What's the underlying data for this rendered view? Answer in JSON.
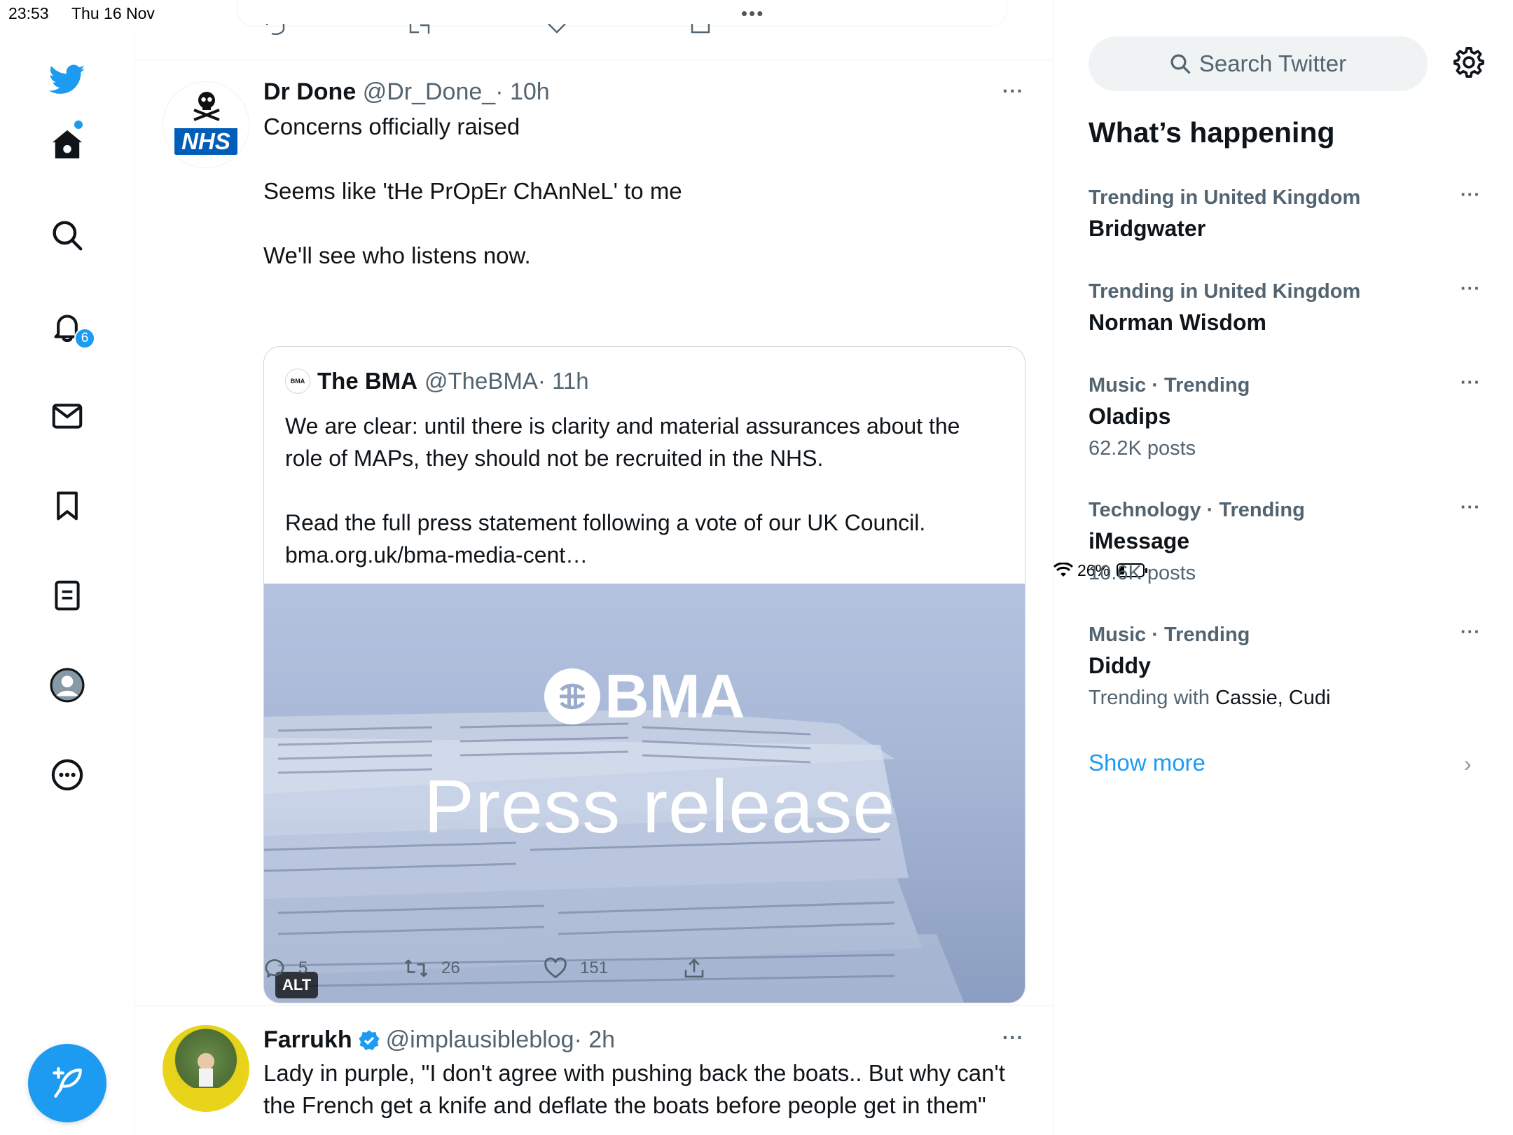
{
  "status": {
    "time": "23:53",
    "date": "Thu 16 Nov",
    "battery": "26%",
    "battery_level": 0.26
  },
  "nav": {
    "items": [
      "home",
      "explore",
      "notifications",
      "messages",
      "bookmarks",
      "lists",
      "profile",
      "more"
    ],
    "notifications_badge": "6"
  },
  "tweet1": {
    "name": "Dr Done",
    "handle": "@Dr_Done_",
    "time": "· 10h",
    "avatar_text": "NHS",
    "text": "Concerns officially raised\n\nSeems like 'tHe PrOpEr ChAnNeL' to me\n\nWe'll see who listens now.",
    "quote": {
      "logo_text": "BMA",
      "name": "The BMA",
      "handle": "@TheBMA",
      "time": "· 11h",
      "text": "We are clear: until there is clarity and material assurances about the role of MAPs, they should not be recruited in the NHS.\n\nRead the full press statement following a vote of our UK Council. bma.org.uk/bma-media-cent…",
      "image_logo": "BMA",
      "image_caption": "Press release",
      "alt_badge": "ALT"
    },
    "replies": "5",
    "retweets": "26",
    "likes": "151"
  },
  "tweet2": {
    "name": "Farrukh",
    "handle": "@implausibleblog",
    "time": "· 2h",
    "text": "Lady in purple, \"I don't agree with pushing back the boats.. But why can't the French get a knife and deflate the boats before people get in them\""
  },
  "right": {
    "search_placeholder": "Search Twitter",
    "heading": "What’s happening",
    "trends": [
      {
        "context": "Trending in United Kingdom",
        "title": "Bridgwater",
        "sub": ""
      },
      {
        "context": "Trending in United Kingdom",
        "title": "Norman Wisdom",
        "sub": ""
      },
      {
        "context": "Music · Trending",
        "title": "Oladips",
        "sub": "62.2K posts"
      },
      {
        "context": "Technology · Trending",
        "title": "iMessage",
        "sub": "10.6K posts"
      },
      {
        "context": "Music · Trending",
        "title": "Diddy",
        "sub_prefix": "Trending with",
        "sub_names": "Cassie, Cudi"
      }
    ],
    "show_more": "Show more"
  },
  "colors": {
    "accent": "#1d9bf0",
    "text": "#0f1419",
    "secondary": "#536471"
  }
}
